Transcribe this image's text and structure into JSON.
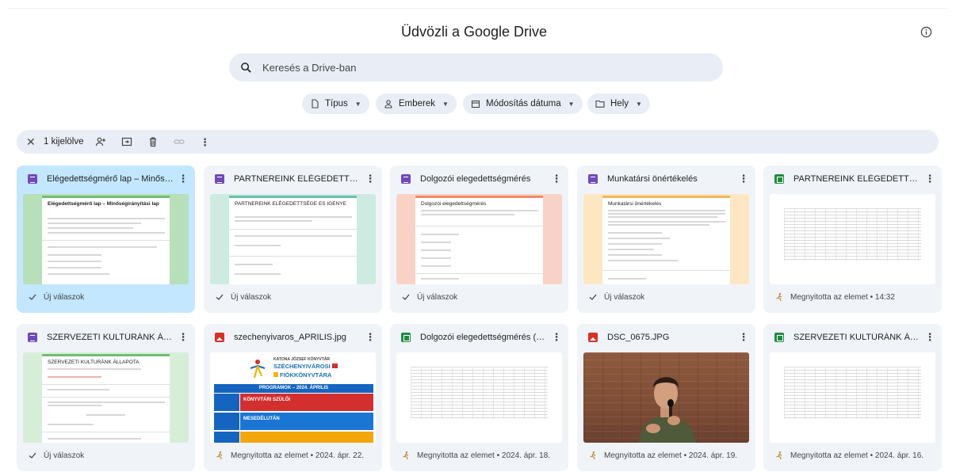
{
  "header": {
    "title": "Üdvözli a Google Drive"
  },
  "search": {
    "placeholder": "Keresés a Drive-ban"
  },
  "filters": [
    {
      "label": "Típus"
    },
    {
      "label": "Emberek"
    },
    {
      "label": "Módosítás dátuma"
    },
    {
      "label": "Hely"
    }
  ],
  "selection": {
    "count_label": "1 kijelölve"
  },
  "files": [
    {
      "title": "Elégedettségmérő lap – Minőség…",
      "type": "forms",
      "footer": "Új válaszok",
      "preview": {
        "title": "Elégedettségmérő lap – Minőségirányítási lap",
        "accent": "#6fbf73"
      }
    },
    {
      "title": "PARTNEREINK ELÉGEDETTSÉGE …",
      "type": "forms",
      "footer": "Új válaszok",
      "preview": {
        "title": "PARTNEREINK ELÉGEDETTSÉGE ES IGENYE",
        "accent": "#67c2a9"
      }
    },
    {
      "title": "Dolgozói elegedettségmérés",
      "type": "forms",
      "footer": "Új válaszok",
      "preview": {
        "title": "Dolgozói elegedettségmérés",
        "accent": "#f08a6c"
      }
    },
    {
      "title": "Munkatársi önértékelés",
      "type": "forms",
      "footer": "Új válaszok",
      "preview": {
        "title": "Munkatársi önértékelés",
        "accent": "#f4b65a"
      }
    },
    {
      "title": "PARTNEREINK ELÉGEDETTSÉGE …",
      "type": "sheets",
      "footer": "Megnyitotta az elemet • 14:32"
    },
    {
      "title": "SZERVEZETI KULTÚRÁNK ÁLLAP…",
      "type": "forms",
      "footer": "Új válaszok",
      "preview": {
        "title": "SZERVEZETI KULTURÁNK ÁLLAPOTA",
        "accent": "#6fbf73"
      }
    },
    {
      "title": "szechenyivaros_APRILIS.jpg",
      "type": "image",
      "footer": "Megnyitotta az elemet • 2024. ápr. 22.",
      "poster": {
        "line1": "KATONA JÓZSEF KÖNYVTÁR",
        "line2": "SZÉCHENYIVÁROSI",
        "line3": "FIÓKKÖNYVTÁRA",
        "band": "PROGRAMOK – 2024. ÁPRILIS",
        "row1": "KÖNYVTÁRI SZÜLŐI",
        "row2": "MESEDÉLUTÁN",
        "colors": {
          "red": "#d32f2f",
          "blue": "#1976d2",
          "orange": "#f4a60d"
        }
      }
    },
    {
      "title": "Dolgozói elegedettségmérés (vál…",
      "type": "sheets",
      "footer": "Megnyitotta az elemet • 2024. ápr. 18."
    },
    {
      "title": "DSC_0675.JPG",
      "type": "image",
      "footer": "Megnyitotta az elemet • 2024. ápr. 19."
    },
    {
      "title": "SZERVEZETI KULTÚRÁNK ÁLLAP…",
      "type": "sheets",
      "footer": "Megnyitotta az elemet • 2024. ápr. 16."
    }
  ],
  "colors": {
    "selected_card": "#c2e7ff",
    "card": "#f0f4f9",
    "chip": "#e9eef6"
  },
  "icons": [
    "info-icon",
    "search-icon",
    "file-type-icon",
    "people-icon",
    "calendar-icon",
    "folder-icon",
    "close-icon",
    "add-person-icon",
    "move-icon",
    "trash-icon",
    "link-icon",
    "more-vert-icon",
    "check-icon",
    "open-icon"
  ]
}
